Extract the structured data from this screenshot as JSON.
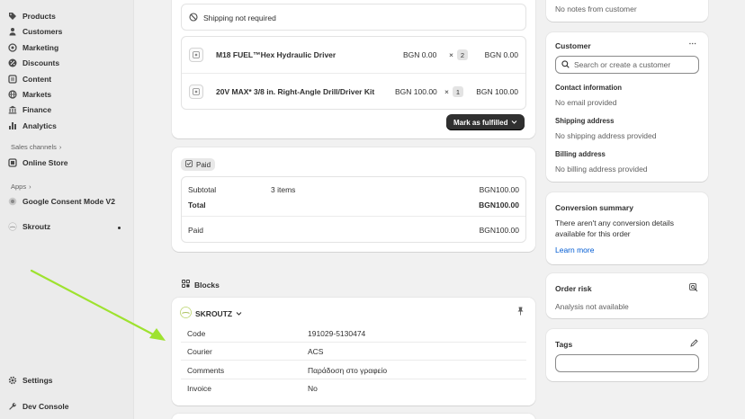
{
  "sidebar": {
    "items": [
      {
        "label": "Products",
        "icon": "tag-icon"
      },
      {
        "label": "Customers",
        "icon": "person-icon"
      },
      {
        "label": "Marketing",
        "icon": "target-icon"
      },
      {
        "label": "Discounts",
        "icon": "discount-icon"
      },
      {
        "label": "Content",
        "icon": "content-icon"
      },
      {
        "label": "Markets",
        "icon": "globe-icon"
      },
      {
        "label": "Finance",
        "icon": "bank-icon"
      },
      {
        "label": "Analytics",
        "icon": "bar-chart-icon"
      }
    ],
    "sales_channels_label": "Sales channels",
    "online_store": "Online Store",
    "apps_label": "Apps",
    "apps": [
      {
        "label": "Google Consent Mode V2"
      },
      {
        "label": "Skroutz"
      }
    ],
    "settings": "Settings",
    "dev_console": "Dev Console"
  },
  "fulfillment": {
    "shipping_note": "Shipping not required",
    "items": [
      {
        "name": "M18 FUEL™Hex Hydraulic Driver",
        "unit_price": "BGN 0.00",
        "times": "×",
        "qty": "2",
        "total": "BGN 0.00"
      },
      {
        "name": "20V MAX* 3/8 in. Right-Angle Drill/Driver Kit",
        "unit_price": "BGN 100.00",
        "times": "×",
        "qty": "1",
        "total": "BGN 100.00"
      }
    ],
    "mark_fulfilled": "Mark as fulfilled"
  },
  "payment": {
    "status": "Paid",
    "subtotal_label": "Subtotal",
    "subtotal_items": "3 items",
    "subtotal_value": "BGN100.00",
    "total_label": "Total",
    "total_value": "BGN100.00",
    "paid_label": "Paid",
    "paid_value": "BGN100.00"
  },
  "blocks": {
    "title": "Blocks",
    "app_name": "SKROUTZ",
    "rows": [
      {
        "label": "Code",
        "value": "191029-5130474"
      },
      {
        "label": "Courier",
        "value": "ACS"
      },
      {
        "label": "Comments",
        "value": "Παράδοση στο γραφείο"
      },
      {
        "label": "Invoice",
        "value": "No"
      }
    ]
  },
  "notes": {
    "text": "No notes from customer"
  },
  "customer": {
    "title": "Customer",
    "search_placeholder": "Search or create a customer",
    "contact_label": "Contact information",
    "contact_value": "No email provided",
    "shipping_label": "Shipping address",
    "shipping_value": "No shipping address provided",
    "billing_label": "Billing address",
    "billing_value": "No billing address provided"
  },
  "conversion": {
    "title": "Conversion summary",
    "line1": "There aren't any conversion details",
    "line2": "available for this order",
    "learn_more": "Learn more"
  },
  "risk": {
    "title": "Order risk",
    "value": "Analysis not available"
  },
  "tags": {
    "title": "Tags"
  },
  "colors": {
    "arrow": "#9ee22f",
    "link": "#005bd3",
    "button_dark": "#303030"
  }
}
